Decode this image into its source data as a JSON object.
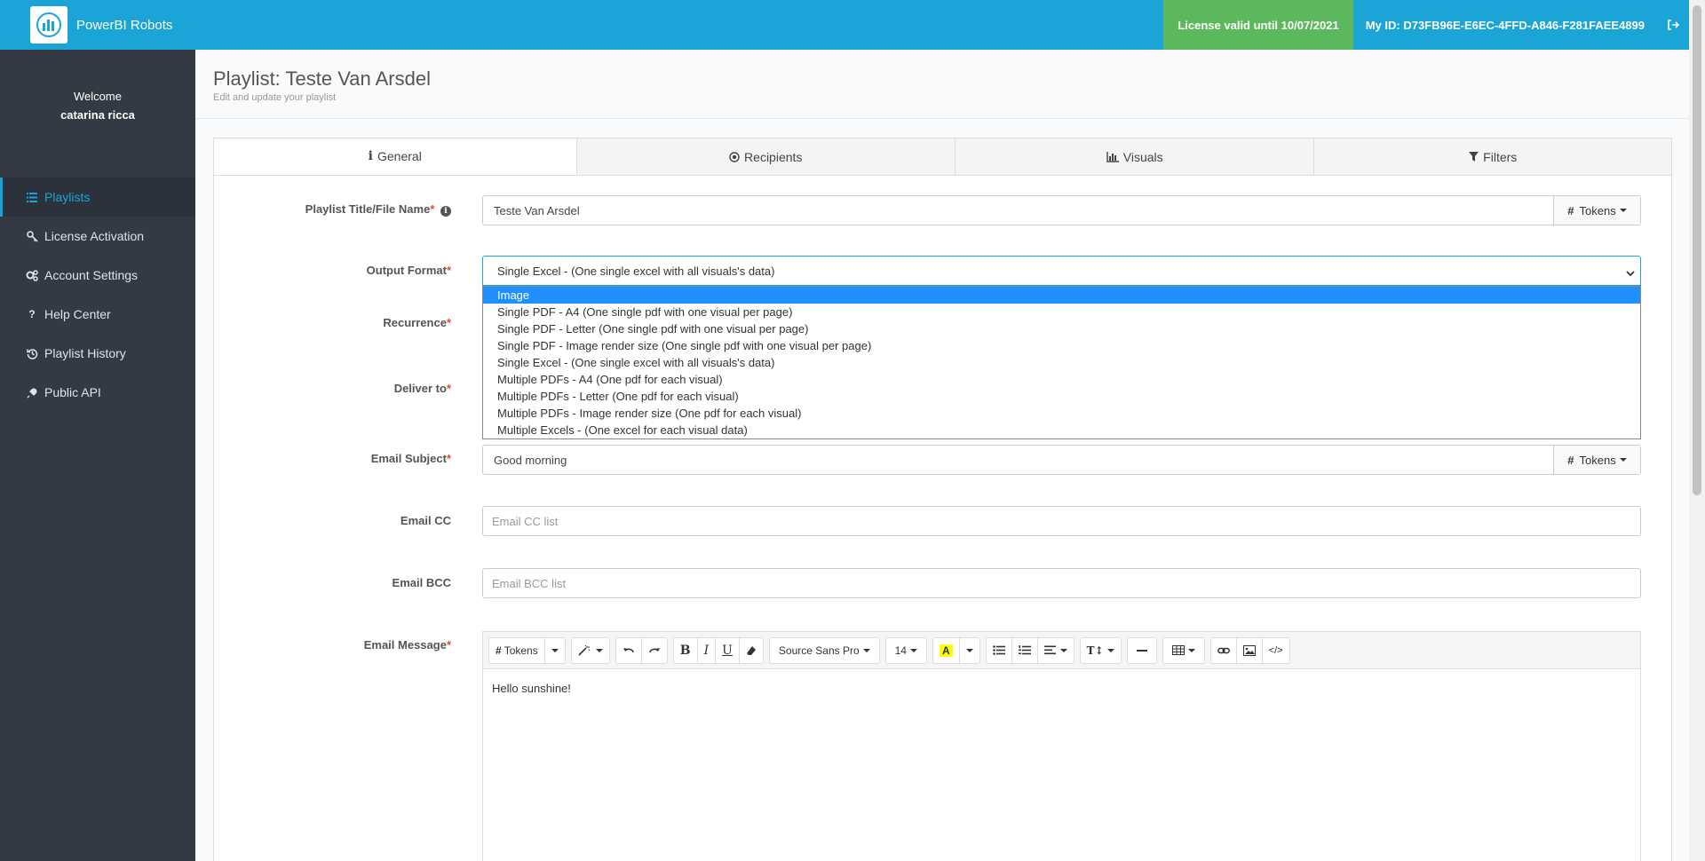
{
  "app": {
    "name": "PowerBI Robots"
  },
  "header": {
    "license": "License valid until 10/07/2021",
    "my_id": "My ID: D73FB96E-E6EC-4FFD-A846-F281FAEE4899"
  },
  "sidebar": {
    "welcome": "Welcome",
    "user": "catarina ricca",
    "items": [
      {
        "label": "Playlists",
        "icon": "list-icon"
      },
      {
        "label": "License Activation",
        "icon": "key-icon"
      },
      {
        "label": "Account Settings",
        "icon": "gears-icon"
      },
      {
        "label": "Help Center",
        "icon": "question-icon"
      },
      {
        "label": "Playlist History",
        "icon": "history-icon"
      },
      {
        "label": "Public API",
        "icon": "plug-icon"
      }
    ]
  },
  "page": {
    "title": "Playlist: Teste Van Arsdel",
    "subtitle": "Edit and update your playlist"
  },
  "tabs": [
    {
      "label": "General",
      "icon": "info-icon"
    },
    {
      "label": "Recipients",
      "icon": "dot-circle-icon"
    },
    {
      "label": "Visuals",
      "icon": "bar-chart-icon"
    },
    {
      "label": "Filters",
      "icon": "filter-icon"
    }
  ],
  "form": {
    "title_label": "Playlist Title/File Name",
    "title_value": "Teste Van Arsdel",
    "tokens": "Tokens",
    "output_label": "Output Format",
    "output_value": "Single Excel - (One single excel with all visuals's data)",
    "output_options": [
      "Image",
      "Single PDF - A4 (One single pdf with one visual per page)",
      "Single PDF - Letter (One single pdf with one visual per page)",
      "Single PDF - Image render size (One single pdf with one visual per page)",
      "Single Excel - (One single excel with all visuals's data)",
      "Multiple PDFs - A4 (One pdf for each visual)",
      "Multiple PDFs - Letter (One pdf for each visual)",
      "Multiple PDFs - Image render size (One pdf for each visual)",
      "Multiple Excels - (One excel for each visual data)"
    ],
    "recurrence_label": "Recurrence",
    "deliver_label": "Deliver to",
    "subject_label": "Email Subject",
    "subject_value": "Good morning",
    "cc_label": "Email CC",
    "cc_placeholder": "Email CC list",
    "bcc_label": "Email BCC",
    "bcc_placeholder": "Email BCC list",
    "message_label": "Email Message",
    "message_value": "Hello sunshine!",
    "font_name": "Source Sans Pro",
    "font_size": "14"
  }
}
